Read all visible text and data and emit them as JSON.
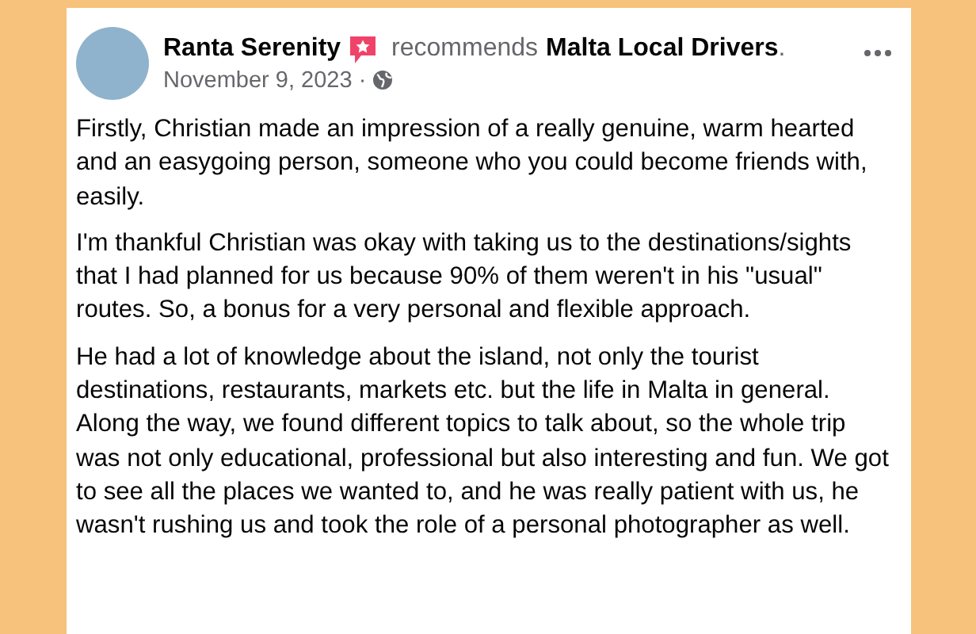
{
  "post": {
    "author": "Ranta Serenity",
    "action": "recommends",
    "page": "Malta Local Drivers",
    "period": ".",
    "date": "November 9, 2023 ·",
    "paragraphs": [
      "Firstly, Christian made an impression of a really genuine, warm hearted and an easygoing person, someone who you could become friends with, easily.",
      "I'm thankful Christian was okay with taking us to the destinations/sights that I had planned for us because 90% of them weren't in his \"usual\" routes. So, a bonus for a very personal and flexible approach.",
      "He had a lot of knowledge about the island, not only the tourist destinations, restaurants, markets etc. but the life in Malta in general. Along the way, we found different topics to talk about, so the whole trip was not only educational, professional but also interesting and fun. We got to see all the places we wanted to, and he was really patient with us, he wasn't rushing us and took the role of a personal photographer as well."
    ]
  }
}
